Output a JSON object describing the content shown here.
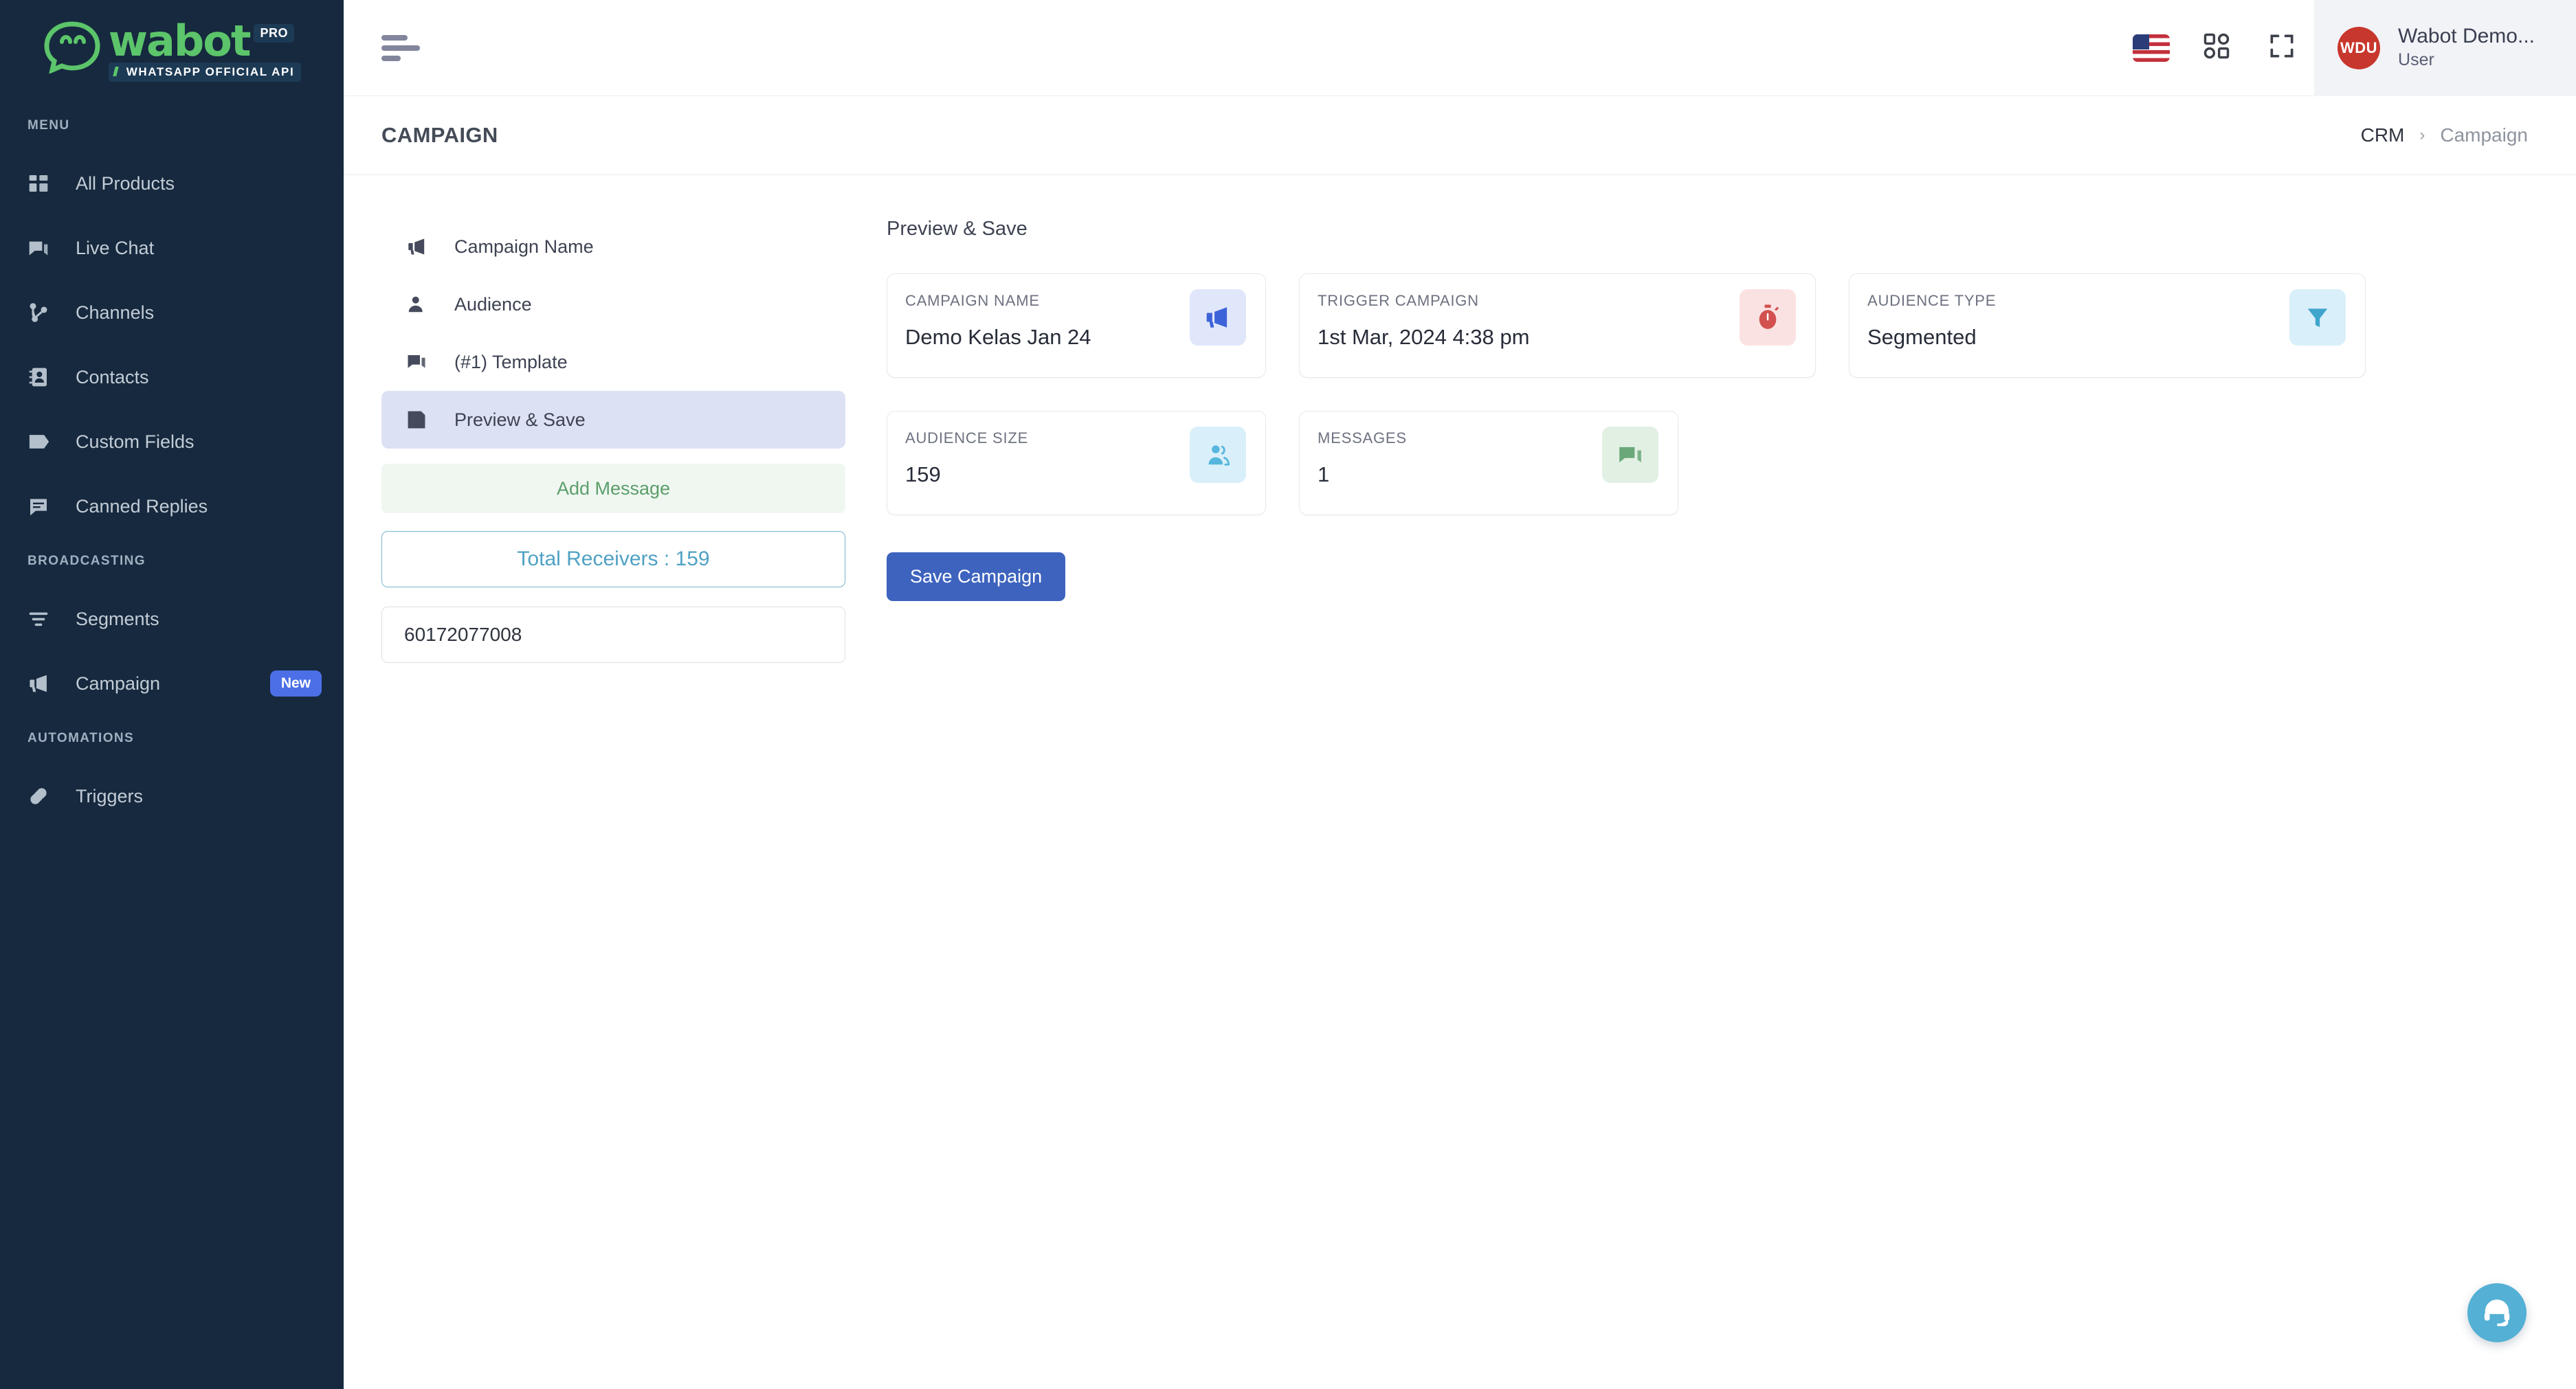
{
  "brand": {
    "name": "wabot",
    "pro": "PRO",
    "tagline": "WHATSAPP OFFICIAL API",
    "green": "#5cc46a",
    "sidebar_bg": "#16293e"
  },
  "sidebar": {
    "sections": [
      {
        "label": "MENU",
        "items": [
          {
            "label": "All Products",
            "icon": "grid-icon",
            "badge": ""
          },
          {
            "label": "Live Chat",
            "icon": "chat-icon",
            "badge": ""
          },
          {
            "label": "Channels",
            "icon": "channels-icon",
            "badge": ""
          },
          {
            "label": "Contacts",
            "icon": "contacts-icon",
            "badge": ""
          },
          {
            "label": "Custom Fields",
            "icon": "tag-icon",
            "badge": ""
          },
          {
            "label": "Canned Replies",
            "icon": "canned-reply-icon",
            "badge": ""
          }
        ]
      },
      {
        "label": "BROADCASTING",
        "items": [
          {
            "label": "Segments",
            "icon": "filter-icon",
            "badge": ""
          },
          {
            "label": "Campaign",
            "icon": "megaphone-icon",
            "badge": "New"
          }
        ]
      },
      {
        "label": "AUTOMATIONS",
        "items": [
          {
            "label": "Triggers",
            "icon": "link-icon",
            "badge": ""
          }
        ]
      }
    ]
  },
  "topbar": {
    "menu_toggle": "hamburger-icon",
    "language_flag": "us-flag-icon",
    "apps_icon": "apps-grid-icon",
    "fullscreen_icon": "fullscreen-icon",
    "user": {
      "initials": "WDU",
      "name": "Wabot Demo...",
      "role": "User",
      "avatar_color": "#c8372d"
    }
  },
  "pageheader": {
    "title": "CAMPAIGN",
    "breadcrumb": {
      "root": "CRM",
      "separator": "›",
      "current": "Campaign"
    }
  },
  "steps": {
    "items": [
      {
        "label": "Campaign Name",
        "icon": "megaphone-icon",
        "active": false
      },
      {
        "label": "Audience",
        "icon": "user-icon",
        "active": false
      },
      {
        "label": "(#1) Template",
        "icon": "template-icon",
        "active": false
      },
      {
        "label": "Preview & Save",
        "icon": "save-icon",
        "active": true
      }
    ],
    "add_message": "Add Message",
    "total_receivers": "Total Receivers : 159",
    "phone_value": "60172077008"
  },
  "preview": {
    "title": "Preview & Save",
    "cards": [
      {
        "label": "CAMPAIGN NAME",
        "value": "Demo Kelas Jan 24",
        "icon": "megaphone-icon",
        "icon_style": "ico-blue",
        "size": "card-sm"
      },
      {
        "label": "TRIGGER CAMPAIGN",
        "value": "1st Mar, 2024 4:38 pm",
        "icon": "stopwatch-icon",
        "icon_style": "ico-red",
        "size": "card-md"
      },
      {
        "label": "AUDIENCE TYPE",
        "value": "Segmented",
        "icon": "funnel-icon",
        "icon_style": "ico-cyan",
        "size": "card-md"
      },
      {
        "label": "AUDIENCE SIZE",
        "value": "159",
        "icon": "people-icon",
        "icon_style": "ico-lblue",
        "size": "card-sm"
      },
      {
        "label": "MESSAGES",
        "value": "1",
        "icon": "messages-icon",
        "icon_style": "ico-green",
        "size": "card-sm"
      }
    ],
    "save_button": "Save Campaign"
  },
  "support": {
    "fab_icon": "headset-support-icon"
  }
}
